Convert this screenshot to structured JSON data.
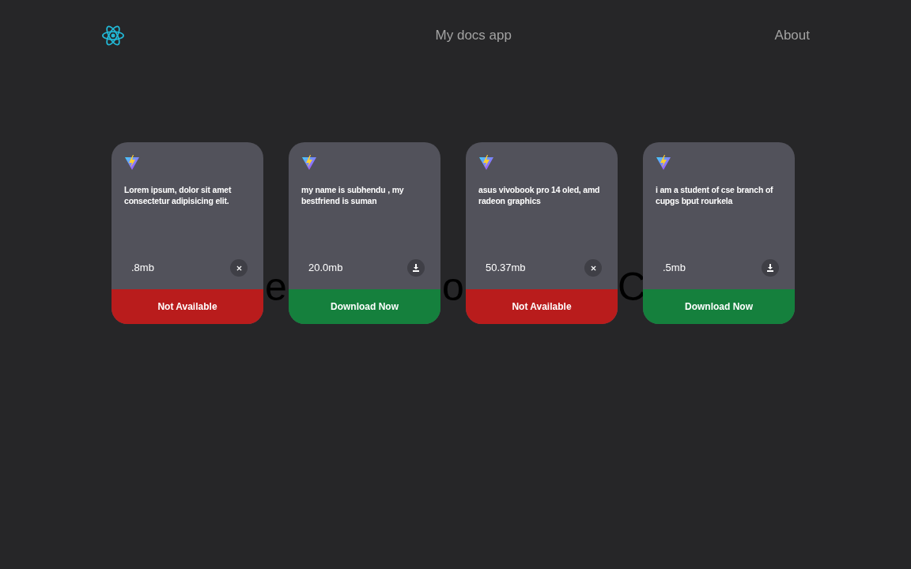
{
  "navbar": {
    "title": "My docs app",
    "link": "About"
  },
  "heading_fragments": [
    "e",
    "o",
    "C"
  ],
  "cards": [
    {
      "description": "Lorem ipsum, dolor sit amet consectetur adipisicing elit.",
      "size": ".8mb",
      "available": false,
      "action": "Not Available"
    },
    {
      "description": "my name is subhendu , my bestfriend is suman",
      "size": "20.0mb",
      "available": true,
      "action": "Download Now"
    },
    {
      "description": "asus vivobook pro 14 oled, amd radeon graphics",
      "size": "50.37mb",
      "available": false,
      "action": "Not Available"
    },
    {
      "description": "i am a student of cse branch of cupgs bput rourkela",
      "size": ".5mb",
      "available": true,
      "action": "Download Now"
    }
  ]
}
